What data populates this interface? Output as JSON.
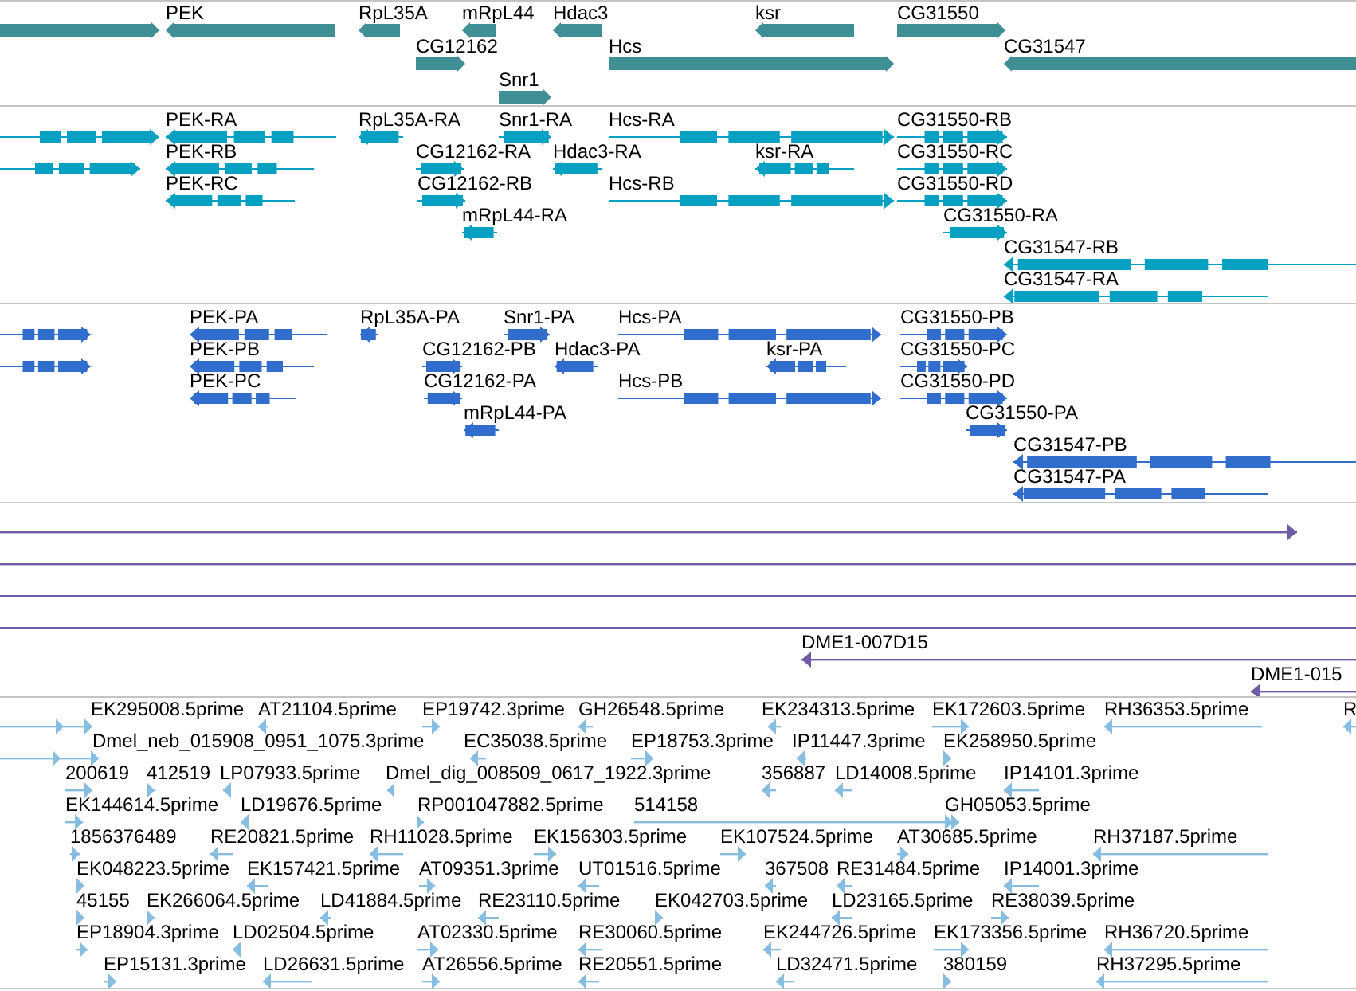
{
  "tracks": [
    {
      "kind": "gene",
      "color": "#3f8f94",
      "features": [
        {
          "reverse": false
        },
        {
          "label": "PEK",
          "reverse": true
        },
        {
          "label": "RpL35A",
          "reverse": true
        },
        {
          "label": "mRpL44",
          "reverse": true
        },
        {
          "label": "Hdac3",
          "reverse": true
        },
        {
          "label": "ksr",
          "reverse": true
        },
        {
          "label": "CG31550",
          "reverse": false
        },
        {
          "label": "CG12162",
          "reverse": false
        },
        {
          "label": "Hcs",
          "reverse": false
        },
        {
          "label": "CG31547",
          "reverse": true
        },
        {
          "label": "Snr1",
          "reverse": false
        }
      ]
    },
    {
      "kind": "transcript",
      "color": "#05a0c2",
      "features": [
        {
          "reverse": false
        },
        {
          "label": "PEK-RA",
          "reverse": true
        },
        {
          "label": "RpL35A-RA",
          "reverse": true
        },
        {
          "label": "Snr1-RA",
          "reverse": false
        },
        {
          "label": "Hcs-RA",
          "reverse": false
        },
        {
          "label": "CG31550-RB",
          "reverse": false
        },
        {
          "reverse": false
        },
        {
          "label": "PEK-RB",
          "reverse": true
        },
        {
          "label": "CG12162-RA",
          "reverse": false
        },
        {
          "label": "Hdac3-RA",
          "reverse": true
        },
        {
          "label": "ksr-RA",
          "reverse": true
        },
        {
          "label": "CG31550-RC",
          "reverse": false
        },
        {
          "label": "PEK-RC",
          "reverse": true
        },
        {
          "label": "CG12162-RB",
          "reverse": false
        },
        {
          "label": "Hcs-RB",
          "reverse": false
        },
        {
          "label": "CG31550-RD",
          "reverse": false
        },
        {
          "label": "mRpL44-RA",
          "reverse": true
        },
        {
          "label": "CG31550-RA",
          "reverse": false
        },
        {
          "label": "CG31547-RB",
          "reverse": true
        },
        {
          "label": "CG31547-RA",
          "reverse": true
        }
      ]
    },
    {
      "kind": "protein",
      "color": "#316dcd",
      "features": [
        {
          "reverse": false
        },
        {
          "label": "PEK-PA",
          "reverse": true
        },
        {
          "label": "RpL35A-PA",
          "reverse": true
        },
        {
          "label": "Snr1-PA",
          "reverse": false
        },
        {
          "label": "Hcs-PA",
          "reverse": false
        },
        {
          "label": "CG31550-PB",
          "reverse": false
        },
        {
          "reverse": false
        },
        {
          "label": "PEK-PB",
          "reverse": true
        },
        {
          "label": "CG12162-PB",
          "reverse": false
        },
        {
          "label": "Hdac3-PA",
          "reverse": true
        },
        {
          "label": "ksr-PA",
          "reverse": true
        },
        {
          "label": "CG31550-PC",
          "reverse": false
        },
        {
          "label": "PEK-PC",
          "reverse": true
        },
        {
          "label": "CG12162-PA",
          "reverse": false
        },
        {
          "label": "Hcs-PB",
          "reverse": false
        },
        {
          "label": "CG31550-PD",
          "reverse": false
        },
        {
          "label": "mRpL44-PA",
          "reverse": true
        },
        {
          "label": "CG31550-PA",
          "reverse": false
        },
        {
          "label": "CG31547-PB",
          "reverse": true
        },
        {
          "label": "CG31547-PA",
          "reverse": true
        }
      ]
    },
    {
      "kind": "clone",
      "color": "#6f5aa8",
      "features": [
        {
          "reverse": false
        },
        {
          "reverse": false
        },
        {
          "reverse": false
        },
        {
          "reverse": false
        },
        {
          "label": "DME1-007D15",
          "reverse": true
        },
        {
          "label": "DME1-015",
          "reverse": true
        }
      ]
    },
    {
      "kind": "est",
      "color": "#86bde0",
      "features": [
        {
          "reverse": false
        },
        {
          "label": "EK295008.5prime",
          "reverse": false
        },
        {
          "label": "AT21104.5prime",
          "reverse": true
        },
        {
          "label": "EP19742.3prime",
          "reverse": false
        },
        {
          "label": "GH26548.5prime",
          "reverse": true
        },
        {
          "label": "EK234313.5prime",
          "reverse": true
        },
        {
          "label": "EK172603.5prime",
          "reverse": false
        },
        {
          "label": "RH36353.5prime",
          "reverse": true
        },
        {
          "label": "R",
          "reverse": true
        },
        {
          "reverse": false
        },
        {
          "label": "Dmel_neb_015908_0951_1075.3prime",
          "reverse": false
        },
        {
          "label": "EC35038.5prime",
          "reverse": true
        },
        {
          "label": "EP18753.3prime",
          "reverse": false
        },
        {
          "label": "IP11447.3prime",
          "reverse": true
        },
        {
          "label": "EK258950.5prime",
          "reverse": false
        },
        {
          "label": "200619",
          "reverse": false
        },
        {
          "label": "412519",
          "reverse": false
        },
        {
          "label": "LP07933.5prime",
          "reverse": true
        },
        {
          "label": "Dmel_dig_008509_0617_1922.3prime",
          "reverse": true
        },
        {
          "label": "356887",
          "reverse": true
        },
        {
          "label": "LD14008.5prime",
          "reverse": true
        },
        {
          "label": "IP14101.3prime",
          "reverse": true
        },
        {
          "label": "EK144614.5prime",
          "reverse": false
        },
        {
          "label": "LD19676.5prime",
          "reverse": true
        },
        {
          "label": "RP001047882.5prime",
          "reverse": false
        },
        {
          "label": "514158",
          "reverse": false
        },
        {
          "label": "GH05053.5prime",
          "reverse": false
        },
        {
          "label": "1856376489",
          "reverse": false
        },
        {
          "label": "RE20821.5prime",
          "reverse": true
        },
        {
          "label": "RH11028.5prime",
          "reverse": true
        },
        {
          "label": "EK156303.5prime",
          "reverse": false
        },
        {
          "label": "EK107524.5prime",
          "reverse": false
        },
        {
          "label": "AT30685.5prime",
          "reverse": false
        },
        {
          "label": "RH37187.5prime",
          "reverse": true
        },
        {
          "label": "EK048223.5prime",
          "reverse": false
        },
        {
          "label": "EK157421.5prime",
          "reverse": true
        },
        {
          "label": "AT09351.3prime",
          "reverse": false
        },
        {
          "label": "UT01516.5prime",
          "reverse": true
        },
        {
          "label": "367508",
          "reverse": true
        },
        {
          "label": "RE31484.5prime",
          "reverse": true
        },
        {
          "label": "IP14001.3prime",
          "reverse": true
        },
        {
          "label": "45155",
          "reverse": false
        },
        {
          "label": "EK266064.5prime",
          "reverse": false
        },
        {
          "label": "LD41884.5prime",
          "reverse": true
        },
        {
          "label": "RE23110.5prime",
          "reverse": true
        },
        {
          "label": "EK042703.5prime",
          "reverse": false
        },
        {
          "label": "LD23165.5prime",
          "reverse": true
        },
        {
          "label": "RE38039.5prime",
          "reverse": false
        },
        {
          "label": "EP18904.3prime",
          "reverse": false
        },
        {
          "label": "LD02504.5prime",
          "reverse": true
        },
        {
          "label": "AT02330.5prime",
          "reverse": false
        },
        {
          "label": "RE30060.5prime",
          "reverse": true
        },
        {
          "label": "EK244726.5prime",
          "reverse": true
        },
        {
          "label": "EK173356.5prime",
          "reverse": false
        },
        {
          "label": "RH36720.5prime",
          "reverse": true
        },
        {
          "label": "EP15131.3prime",
          "reverse": false
        },
        {
          "label": "LD26631.5prime",
          "reverse": true
        },
        {
          "label": "AT26556.5prime",
          "reverse": false
        },
        {
          "label": "RE20551.5prime",
          "reverse": true
        },
        {
          "label": "LD32471.5prime",
          "reverse": true
        },
        {
          "label": "380159",
          "reverse": false
        },
        {
          "label": "RH37295.5prime",
          "reverse": true
        }
      ]
    }
  ]
}
